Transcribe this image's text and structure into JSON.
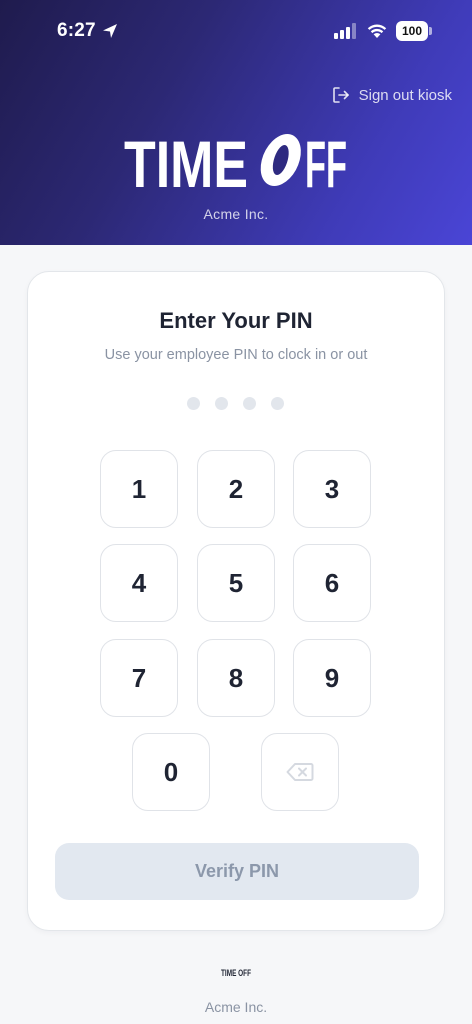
{
  "status_bar": {
    "time": "6:27",
    "battery": "100",
    "icons": [
      "location-arrow-icon",
      "cellular-signal-icon",
      "wifi-icon",
      "battery-icon"
    ]
  },
  "header": {
    "signout_label": "Sign out kiosk",
    "logo_text": "TIME OFF",
    "org_name": "Acme Inc.",
    "gradient_colors": [
      "#1f1b4d",
      "#4a45d6"
    ]
  },
  "pin_card": {
    "title": "Enter Your PIN",
    "subtitle": "Use your employee PIN to clock in or out",
    "pin_length": 4,
    "keys": [
      "1",
      "2",
      "3",
      "4",
      "5",
      "6",
      "7",
      "8",
      "9",
      "0"
    ],
    "verify_label": "Verify PIN"
  },
  "footer": {
    "org_name": "Acme Inc."
  },
  "colors": {
    "accent": "#4a45d6",
    "text_primary": "#1f2433",
    "text_muted": "#8a93a3",
    "disabled_button_bg": "#e2e8f0",
    "disabled_button_text": "#8c98ab"
  }
}
